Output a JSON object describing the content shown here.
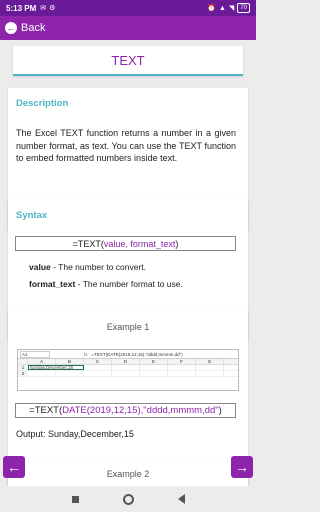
{
  "status": {
    "time": "5:13 PM",
    "battery": "70"
  },
  "appbar": {
    "back_label": "Back"
  },
  "title": "TEXT",
  "description": {
    "heading": "Description",
    "text": "The Excel TEXT function returns a number in a given number format, as text. You can use the TEXT function to embed formatted numbers inside text."
  },
  "syntax": {
    "heading": "Syntax",
    "formula_prefix": "=TEXT(",
    "formula_args": "value, format_text",
    "formula_suffix": ")",
    "params": [
      {
        "name": "value",
        "desc": " - The number to convert."
      },
      {
        "name": "format_text",
        "desc": " - The number format to use."
      }
    ]
  },
  "example1": {
    "heading": "Example 1",
    "sheet": {
      "cell_ref": "A1",
      "fx": "fx",
      "formula": "=TEXT(DATE(2019,12,15),\"dddd,mmmm,dd\")",
      "columns": [
        "A",
        "B",
        "C",
        "D",
        "E",
        "F",
        "G"
      ],
      "rows": [
        "1",
        "2"
      ],
      "cell_value": "Sunday,December,15"
    },
    "formula_prefix": "=TEXT(",
    "formula_inner": "DATE(2019,12,15),\"dddd,mmmm,dd\"",
    "formula_suffix": ")",
    "output": "Output: Sunday,December,15"
  },
  "example2": {
    "heading": "Example 2"
  },
  "nav": {
    "prev_icon": "arrow-left-icon",
    "next_icon": "arrow-right-icon"
  },
  "colors": {
    "primary": "#8e24aa",
    "status": "#6a1b9a",
    "accent": "#4db6c4"
  }
}
